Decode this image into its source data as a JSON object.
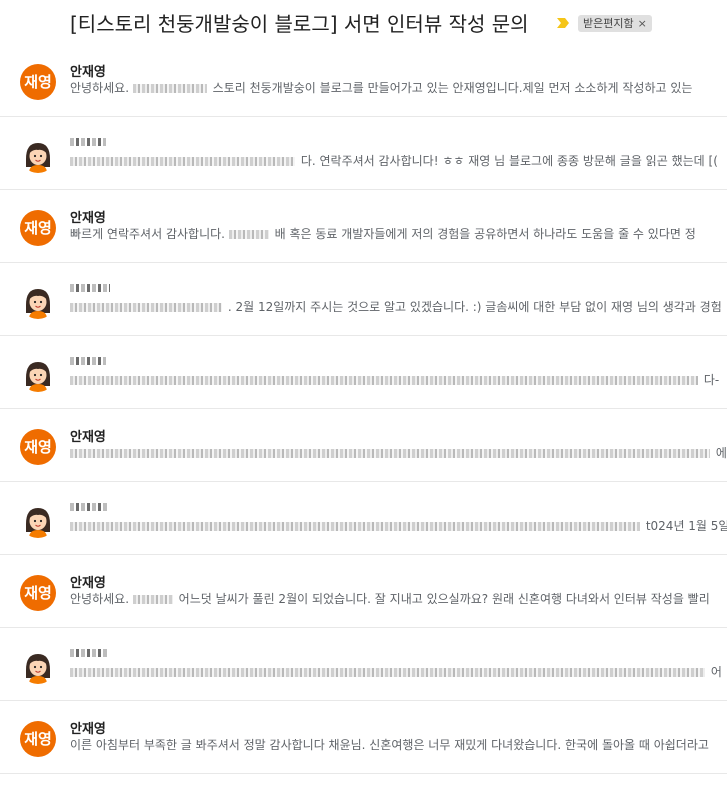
{
  "thread": {
    "subject": "[티스토리 천둥개발숭이 블로그] 서면 인터뷰 작성 문의",
    "label": "받은편지함",
    "label_remove": "×",
    "important_icon": "important-marker-icon",
    "colors": {
      "avatar_orange": "#ef6c00",
      "important_yellow": "#f5c518",
      "chip_bg": "#e0e0e0"
    }
  },
  "messages": [
    {
      "avatar_type": "text",
      "avatar_label": "재영",
      "sender": "안재영",
      "snippet_pre": "안녕하세요.",
      "snippet": "스토리 천둥개발숭이 블로그를 만들어가고 있는 안재영입니다.제일 먼저 소소하게 작성하고 있는"
    },
    {
      "avatar_type": "girl",
      "avatar_label": "",
      "sender": "",
      "snippet_pre": "",
      "snippet": "다. 연락주셔서 감사합니다! ㅎㅎ 재영 님 블로그에 종종 방문해 글을 읽곤 했는데 [("
    },
    {
      "avatar_type": "text",
      "avatar_label": "재영",
      "sender": "안재영",
      "snippet_pre": "빠르게 연락주셔서 감사합니다.",
      "snippet": "배 혹은 동료 개발자들에게 저의 경험을 공유하면서 하나라도 도움을 줄 수 있다면 정"
    },
    {
      "avatar_type": "girl",
      "avatar_label": "",
      "sender": "",
      "snippet_pre": "",
      "snippet": ". 2월 12일까지 주시는 것으로 알고 있겠습니다. :) 글솜씨에 대한 부담 없이 재영 님의 생각과 경험"
    },
    {
      "avatar_type": "girl",
      "avatar_label": "",
      "sender": "",
      "snippet_pre": "",
      "snippet": "다-"
    },
    {
      "avatar_type": "text",
      "avatar_label": "재영",
      "sender": "안재영",
      "snippet_pre": "",
      "snippet": "에"
    },
    {
      "avatar_type": "girl",
      "avatar_label": "",
      "sender": "",
      "snippet_pre": "",
      "snippet": "t024년 1월 5일"
    },
    {
      "avatar_type": "text",
      "avatar_label": "재영",
      "sender": "안재영",
      "snippet_pre": "안녕하세요.",
      "snippet": "어느덧 날씨가 풀린 2월이 되었습니다. 잘 지내고 있으실까요? 원래 신혼여행 다녀와서 인터뷰 작성을 빨리"
    },
    {
      "avatar_type": "girl",
      "avatar_label": "",
      "sender": "",
      "snippet_pre": "",
      "snippet": "어"
    },
    {
      "avatar_type": "text",
      "avatar_label": "재영",
      "sender": "안재영",
      "snippet_pre": "",
      "snippet": "이른 아침부터 부족한 글 봐주셔서 정말 감사합니다 채윤님. 신혼여행은 너무 재밌게 다녀왔습니다. 한국에 돌아올 때 아쉽더라고"
    }
  ]
}
